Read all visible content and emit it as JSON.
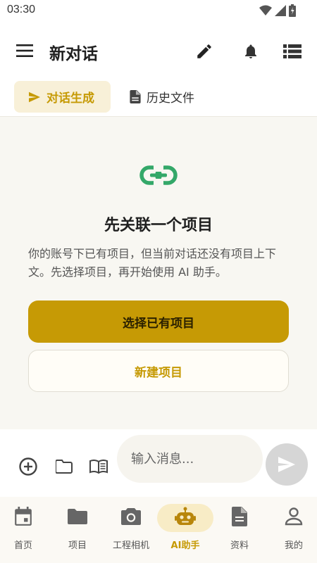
{
  "status_bar": {
    "time": "03:30"
  },
  "app_bar": {
    "title": "新对话",
    "menu_icon": "menu-icon",
    "edit_icon": "edit-icon",
    "bell_icon": "bell-icon",
    "list_icon": "list-icon"
  },
  "tabs": [
    {
      "label": "对话生成",
      "icon": "send-icon",
      "active": true
    },
    {
      "label": "历史文件",
      "icon": "document-icon",
      "active": false
    }
  ],
  "empty_state": {
    "icon": "link-icon",
    "title": "先关联一个项目",
    "description": "你的账号下已有项目，但当前对话还没有项目上下文。先选择项目，再开始使用 AI 助手。",
    "primary_button": "选择已有项目",
    "secondary_button": "新建项目"
  },
  "composer": {
    "placeholder": "输入消息...",
    "add_icon": "add-circle-icon",
    "folder_icon": "folder-icon",
    "book_icon": "book-icon",
    "send_icon": "send-icon"
  },
  "bottom_nav": [
    {
      "label": "首页",
      "icon": "calendar-icon",
      "active": false
    },
    {
      "label": "项目",
      "icon": "folder-icon",
      "active": false
    },
    {
      "label": "工程相机",
      "icon": "camera-icon",
      "active": false
    },
    {
      "label": "AI助手",
      "icon": "robot-icon",
      "active": true
    },
    {
      "label": "资料",
      "icon": "document-icon",
      "active": false
    },
    {
      "label": "我的",
      "icon": "person-icon",
      "active": false
    }
  ],
  "colors": {
    "accent": "#c69a05",
    "accent_soft": "#f8f0d8",
    "link_icon": "#34a869",
    "main_background": "#f8f7f2"
  }
}
